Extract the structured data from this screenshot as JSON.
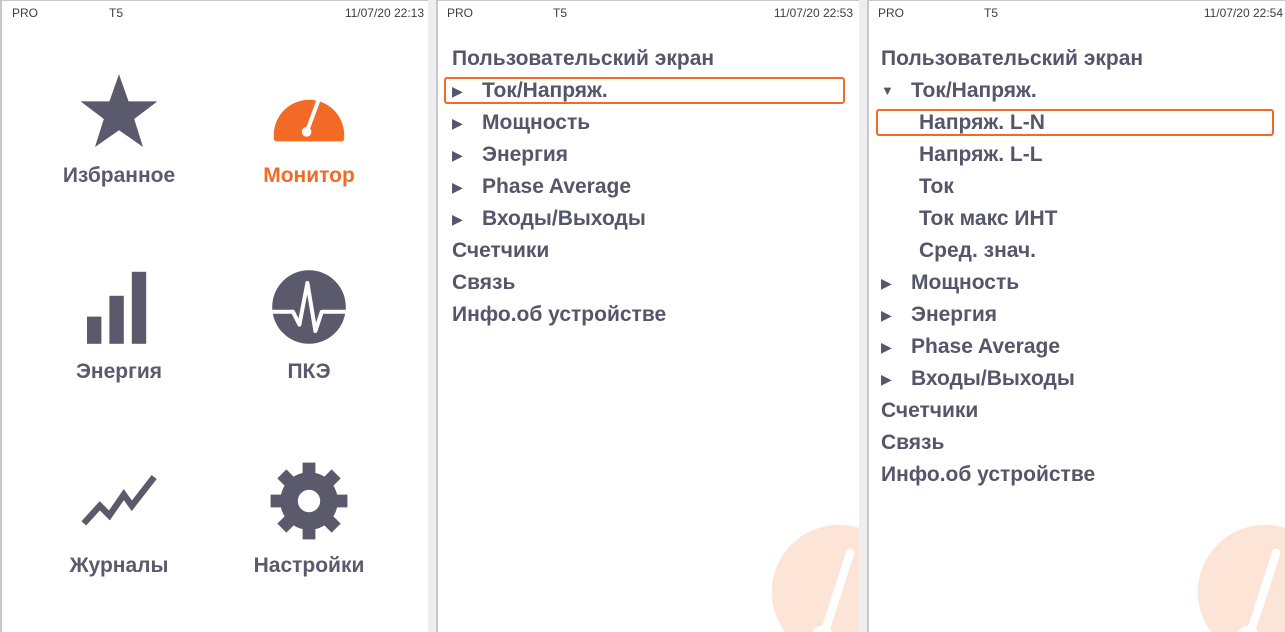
{
  "colors": {
    "accent": "#f26a25",
    "text": "#55566a",
    "icon": "#5a5a6c"
  },
  "panels": [
    {
      "status": {
        "mode": "PRO",
        "device": "T5",
        "datetime": "11/07/20 22:13"
      },
      "tiles": [
        {
          "label": "Избранное",
          "icon": "star-icon",
          "active": false
        },
        {
          "label": "Монитор",
          "icon": "gauge-icon",
          "active": true
        },
        {
          "label": "Энергия",
          "icon": "bar-chart-icon",
          "active": false
        },
        {
          "label": "ПКЭ",
          "icon": "pulse-icon",
          "active": false
        },
        {
          "label": "Журналы",
          "icon": "trend-line-icon",
          "active": false
        },
        {
          "label": "Настройки",
          "icon": "gear-icon",
          "active": false
        }
      ]
    },
    {
      "status": {
        "mode": "PRO",
        "device": "T5",
        "datetime": "11/07/20 22:53"
      },
      "menu": [
        {
          "label": "Пользовательский экран",
          "arrow": "none",
          "level": 0
        },
        {
          "label": "Ток/Напряж.",
          "arrow": "right",
          "level": 0,
          "selected": true
        },
        {
          "label": "Мощность",
          "arrow": "right",
          "level": 0
        },
        {
          "label": "Энергия",
          "arrow": "right",
          "level": 0
        },
        {
          "label": "Phase Average",
          "arrow": "right",
          "level": 0
        },
        {
          "label": "Входы/Выходы",
          "arrow": "right",
          "level": 0
        },
        {
          "label": "Счетчики",
          "arrow": "none",
          "level": 0
        },
        {
          "label": "Связь",
          "arrow": "none",
          "level": 0
        },
        {
          "label": "Инфо.об устройстве",
          "arrow": "none",
          "level": 0
        }
      ]
    },
    {
      "status": {
        "mode": "PRO",
        "device": "T5",
        "datetime": "11/07/20 22:54"
      },
      "menu": [
        {
          "label": "Пользовательский экран",
          "arrow": "none",
          "level": 0
        },
        {
          "label": "Ток/Напряж.",
          "arrow": "down",
          "level": 0
        },
        {
          "label": "Напряж. L-N",
          "arrow": "none",
          "level": 1,
          "selected": true
        },
        {
          "label": "Напряж. L-L",
          "arrow": "none",
          "level": 1
        },
        {
          "label": "Ток",
          "arrow": "none",
          "level": 1
        },
        {
          "label": "Ток макс ИНТ",
          "arrow": "none",
          "level": 1
        },
        {
          "label": "Сред. знач.",
          "arrow": "none",
          "level": 1
        },
        {
          "label": "Мощность",
          "arrow": "right",
          "level": 0
        },
        {
          "label": "Энергия",
          "arrow": "right",
          "level": 0
        },
        {
          "label": "Phase Average",
          "arrow": "right",
          "level": 0
        },
        {
          "label": "Входы/Выходы",
          "arrow": "right",
          "level": 0
        },
        {
          "label": "Счетчики",
          "arrow": "none",
          "level": 0
        },
        {
          "label": "Связь",
          "arrow": "none",
          "level": 0
        },
        {
          "label": "Инфо.об устройстве",
          "arrow": "none",
          "level": 0
        }
      ]
    }
  ]
}
